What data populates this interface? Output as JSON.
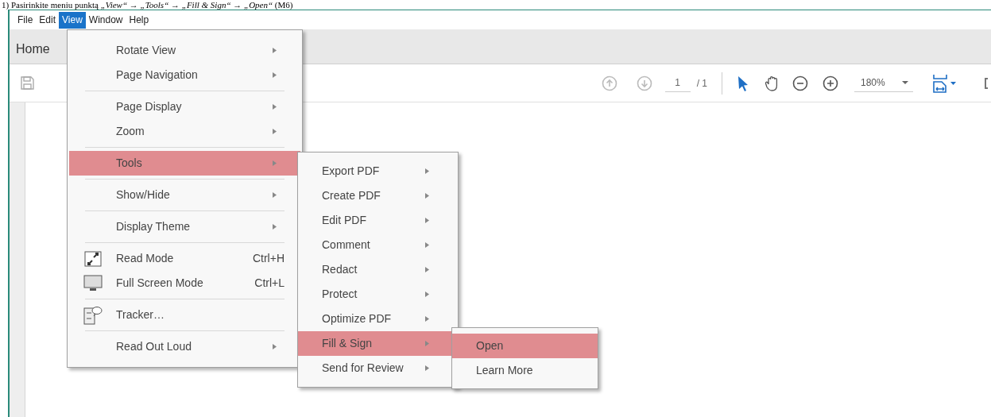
{
  "caption": "1) Pasirinkite meniu punktą *„View“* → *„Tools“* → *„Fill & Sign“* → *„Open“* (M6)",
  "menu_bar": [
    {
      "label": "File",
      "selected": false
    },
    {
      "label": "Edit",
      "selected": false
    },
    {
      "label": "View",
      "selected": true
    },
    {
      "label": "Window",
      "selected": false
    },
    {
      "label": "Help",
      "selected": false
    }
  ],
  "tabs": [
    {
      "label": "Home",
      "selected": true
    }
  ],
  "toolbar": {
    "page_number": "1",
    "page_total": "/ 1",
    "zoom": "180%"
  },
  "view_menu": {
    "groups": [
      [
        {
          "kind": "submenu",
          "label": "Rotate View",
          "selected": false
        },
        {
          "kind": "submenu",
          "label": "Page Navigation",
          "selected": false
        }
      ],
      [
        {
          "kind": "submenu",
          "label": "Page Display",
          "selected": false
        },
        {
          "kind": "submenu",
          "label": "Zoom",
          "selected": false
        }
      ],
      [
        {
          "kind": "submenu",
          "label": "Tools",
          "selected": true
        }
      ],
      [
        {
          "kind": "submenu",
          "label": "Show/Hide",
          "selected": false
        }
      ],
      [
        {
          "kind": "submenu",
          "label": "Display Theme",
          "selected": false
        }
      ],
      [
        {
          "kind": "command",
          "label": "Read Mode",
          "shortcut": "Ctrl+H",
          "selected": false
        },
        {
          "kind": "command",
          "label": "Full Screen Mode",
          "shortcut": "Ctrl+L",
          "selected": false
        }
      ],
      [
        {
          "kind": "command",
          "label": "Tracker…",
          "selected": false
        }
      ],
      [
        {
          "kind": "submenu",
          "label": "Read Out Loud",
          "selected": false
        }
      ]
    ]
  },
  "tools_menu": [
    {
      "label": "Export PDF",
      "selected": false
    },
    {
      "label": "Create PDF",
      "selected": false
    },
    {
      "label": "Edit PDF",
      "selected": false
    },
    {
      "label": "Comment",
      "selected": false
    },
    {
      "label": "Redact",
      "selected": false
    },
    {
      "label": "Protect",
      "selected": false
    },
    {
      "label": "Optimize PDF",
      "selected": false
    },
    {
      "label": "Fill & Sign",
      "selected": true
    },
    {
      "label": "Send for Review",
      "selected": false
    }
  ],
  "fill_sign_menu": [
    {
      "label": "Open",
      "selected": true
    },
    {
      "label": "Learn More",
      "selected": false
    }
  ]
}
